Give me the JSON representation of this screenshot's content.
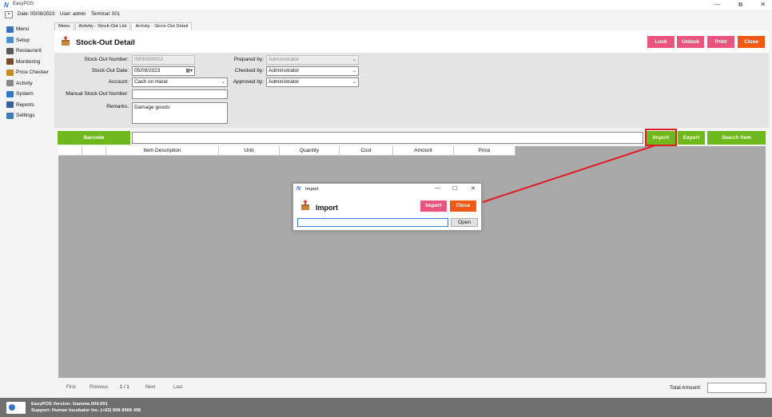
{
  "window": {
    "title": "EasyPOS",
    "logo": "N",
    "controls": [
      "—",
      "⧉",
      "✕"
    ]
  },
  "info": {
    "date": "Date: 05/09/2023",
    "user": "User: admin",
    "terminal": "Terminal: 001",
    "menu_glyph": "▪"
  },
  "sidebar": {
    "items": [
      {
        "label": "Menu",
        "icon": "menu-icon",
        "color": "#3b6fb6"
      },
      {
        "label": "Setup",
        "icon": "setup-icon",
        "color": "#4a8fd1"
      },
      {
        "label": "Restaurant",
        "icon": "restaurant-icon",
        "color": "#5a5a5a"
      },
      {
        "label": "Monitoring",
        "icon": "monitoring-icon",
        "color": "#7a4b2e"
      },
      {
        "label": "Price Checker",
        "icon": "price-checker-icon",
        "color": "#c78b2a"
      },
      {
        "label": "Activity",
        "icon": "activity-icon",
        "color": "#888"
      },
      {
        "label": "System",
        "icon": "system-icon",
        "color": "#2f78c4"
      },
      {
        "label": "Reports",
        "icon": "reports-icon",
        "color": "#3a5f9e"
      },
      {
        "label": "Settings",
        "icon": "settings-icon",
        "color": "#3d7ab8"
      }
    ]
  },
  "tabs": [
    "Menu",
    "Activity - Stock-Out List",
    "Activity - Stock-Out Detail"
  ],
  "header": {
    "title": "Stock-Out Detail",
    "buttons": {
      "lock": "Lock",
      "unlock": "Unlock",
      "print": "Print",
      "close": "Close"
    }
  },
  "form": {
    "stock_out_number": {
      "label": "Stock-Out Number:",
      "value": "0000000002"
    },
    "stock_out_date": {
      "label": "Stock-Out Date:",
      "value": "05/09/2023"
    },
    "account": {
      "label": "Account:",
      "value": "Cash on Hand"
    },
    "manual_number": {
      "label": "Manual Stock-Out Number:",
      "value": ""
    },
    "remarks": {
      "label": "Remarks:",
      "value": "Damage goods"
    },
    "prepared_by": {
      "label": "Prepared by:",
      "value": "Administrator"
    },
    "checked_by": {
      "label": "Checked by:",
      "value": "Administrator"
    },
    "approved_by": {
      "label": "Approved by:",
      "value": "Administrator"
    }
  },
  "barcode_bar": {
    "barcode": "Barcode",
    "import": "Import",
    "export": "Export",
    "search_item": "Search Item"
  },
  "grid": {
    "columns": [
      "",
      "",
      "Item Description",
      "Unit",
      "Quantity",
      "Cost",
      "Amount",
      "Price"
    ]
  },
  "pager": {
    "first": "First",
    "previous": "Previous",
    "page": "1 / 1",
    "next": "Next",
    "last": "Last",
    "total_label": "Total Amount:",
    "total_value": ""
  },
  "status": {
    "version": "EasyPOS Version: Gamma.004.001",
    "support": "Support: Human Incubator Inc. (+63) 908 8906 496"
  },
  "dialog": {
    "title": "Import",
    "heading": "Import",
    "import_btn": "Import",
    "close_btn": "Close",
    "open_btn": "Open",
    "file_path": "",
    "controls": [
      "—",
      "☐",
      "✕"
    ]
  },
  "colors": {
    "green": "#6eb71c",
    "pink": "#e9557c",
    "orange": "#f05a14",
    "callout": "#e01b24"
  }
}
